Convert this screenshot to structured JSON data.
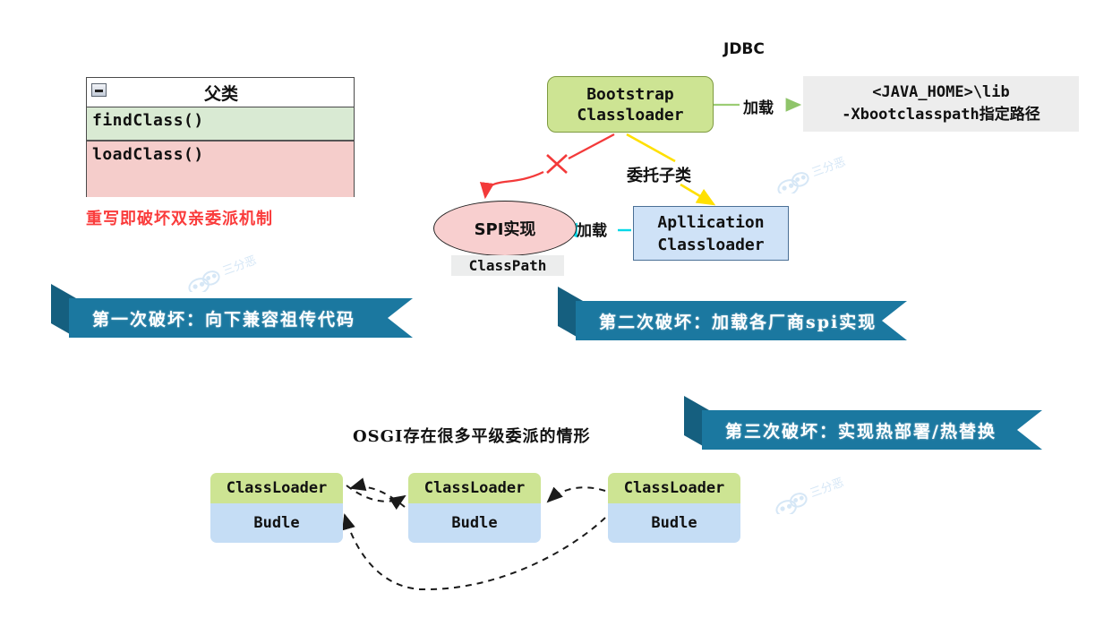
{
  "class_box": {
    "collapse_icon": "minus-icon",
    "title": "父类",
    "rows": [
      {
        "label": "findClass()",
        "color": "#d9ead3"
      },
      {
        "label": "loadClass()",
        "color": "#f5cdcb"
      }
    ],
    "note": "重写即破坏双亲委派机制",
    "note_color": "#fa3c3c"
  },
  "jdbc": {
    "label": "JDBC",
    "bootstrap": {
      "line1": "Bootstrap",
      "line2": "Classloader",
      "color": "#cde493"
    },
    "application": {
      "line1": "Apllication",
      "line2": "Classloader",
      "color": "#cfe2f7"
    },
    "spi": {
      "label": "SPI实现",
      "color": "#f8cfcf"
    },
    "classpath": {
      "label": "ClassPath"
    },
    "lib_box": {
      "line1": "<JAVA_HOME>\\lib",
      "line2": "-Xbootclasspath指定路径"
    },
    "edges": {
      "load_lib": "加载",
      "delegate_child": "委托子类",
      "load_spi": "加载",
      "blocked_marker": "x-cross-icon"
    }
  },
  "ribbons": [
    {
      "text": "第一次破坏：向下兼容祖传代码",
      "color": "#1b78a0"
    },
    {
      "text": "第二次破坏：加载各厂商spi实现",
      "color": "#1b78a0"
    },
    {
      "text": "第三次破坏：实现热部署/热替换",
      "color": "#1b78a0"
    }
  ],
  "osgi": {
    "note": "OSGI存在很多平级委派的情形",
    "bundles": [
      {
        "loader": "ClassLoader",
        "bundle": "Budle"
      },
      {
        "loader": "ClassLoader",
        "bundle": "Budle"
      },
      {
        "loader": "ClassLoader",
        "bundle": "Budle"
      }
    ]
  },
  "watermark": {
    "text": "三分恶",
    "icon": "wechat-bubbles-icon",
    "color": "#cfe3f5"
  }
}
